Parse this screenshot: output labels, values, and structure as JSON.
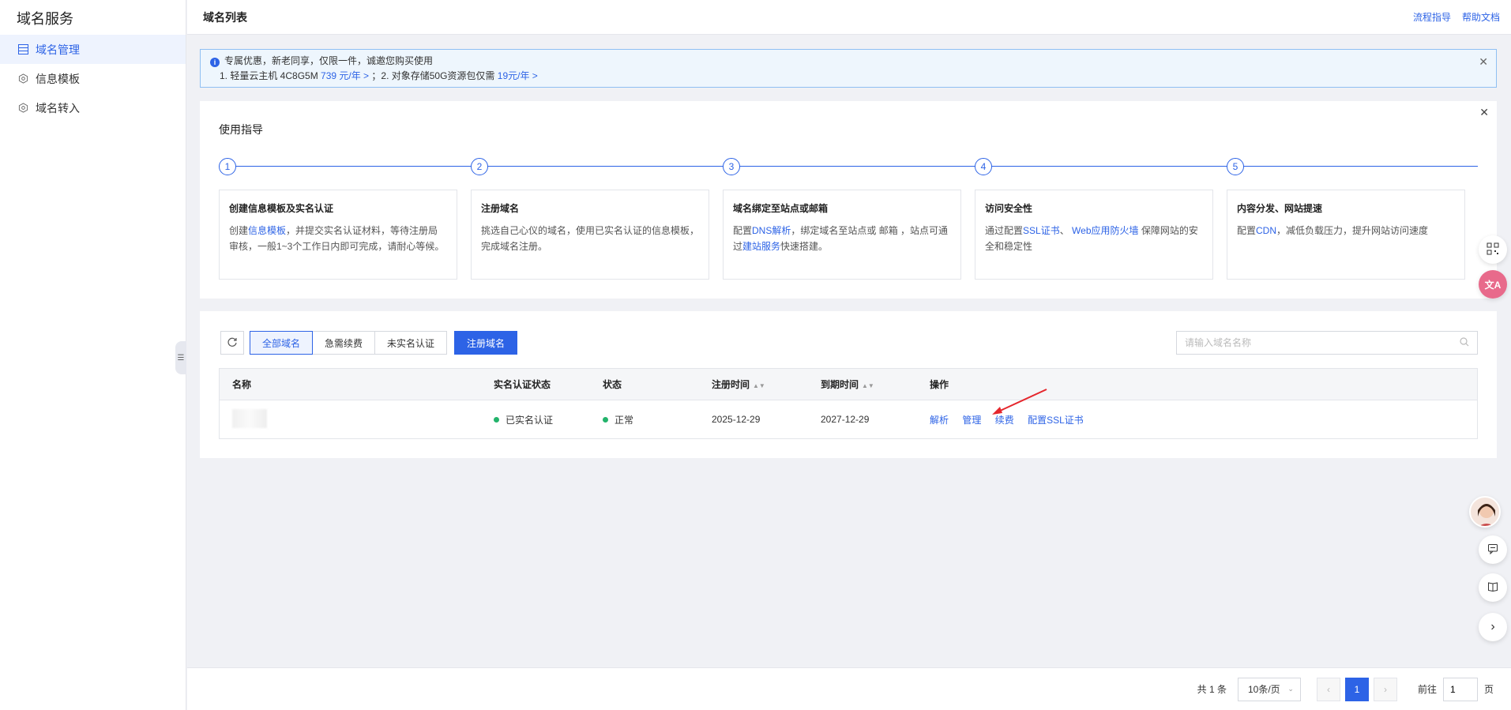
{
  "sidebar": {
    "title": "域名服务",
    "items": [
      {
        "label": "域名管理",
        "icon": "list-icon",
        "active": true
      },
      {
        "label": "信息模板",
        "icon": "hexagon-icon",
        "active": false
      },
      {
        "label": "域名转入",
        "icon": "hexagon-icon",
        "active": false
      }
    ]
  },
  "header": {
    "title": "域名列表",
    "links": [
      "流程指导",
      "帮助文档"
    ]
  },
  "banner": {
    "line1": "专属优惠，新老同享，仅限一件，诚邀您购买使用",
    "line2_part1": "1. 轻量云主机 4C8G5M ",
    "line2_link1": "739 元/年 >",
    "line2_part2": " ；2. 对象存储50G资源包仅需 ",
    "line2_link2": "19元/年 >"
  },
  "guide": {
    "title": "使用指导",
    "steps": [
      {
        "num": "1",
        "title": "创建信息模板及实名认证",
        "pre": "创建",
        "link": "信息模板",
        "post": "，并提交实名认证材料，等待注册局审核，一般1~3个工作日内即可完成，请耐心等候。"
      },
      {
        "num": "2",
        "title": "注册域名",
        "pre": "挑选自己心仪的域名，使用已实名认证的信息模板，完成域名注册。",
        "link": "",
        "post": ""
      },
      {
        "num": "3",
        "title": "域名绑定至站点或邮箱",
        "pre": "配置",
        "link": "DNS解析",
        "post": "，绑定域名至站点或 邮箱 ，站点可通过",
        "link2": "建站服务",
        "post2": "快速搭建。"
      },
      {
        "num": "4",
        "title": "访问安全性",
        "pre": "通过配置",
        "link": "SSL证书",
        "post": "、 ",
        "link2": "Web应用防火墙",
        "post2": " 保障网站的安全和稳定性"
      },
      {
        "num": "5",
        "title": "内容分发、网站提速",
        "pre": "配置",
        "link": "CDN",
        "post": "，减低负载压力，提升网站访问速度"
      }
    ]
  },
  "list": {
    "filters": [
      "全部域名",
      "急需续费",
      "未实名认证"
    ],
    "register_button": "注册域名",
    "search_placeholder": "请输入域名名称",
    "columns": [
      "名称",
      "实名认证状态",
      "状态",
      "注册时间",
      "到期时间",
      "操作"
    ],
    "rows": [
      {
        "name": "",
        "auth": "已实名认证",
        "status": "正常",
        "reg": "2025-12-29",
        "expire": "2027-12-29",
        "ops": [
          "解析",
          "管理",
          "续费",
          "配置SSL证书"
        ]
      }
    ]
  },
  "pagination": {
    "total": "共 1 条",
    "page_size": "10条/页",
    "current": "1",
    "goto_label": "前往",
    "goto_value": "1",
    "page_unit": "页"
  },
  "colors": {
    "accent": "#2d63e6",
    "success": "#23b36b",
    "annotation_arrow": "#e5262c"
  }
}
